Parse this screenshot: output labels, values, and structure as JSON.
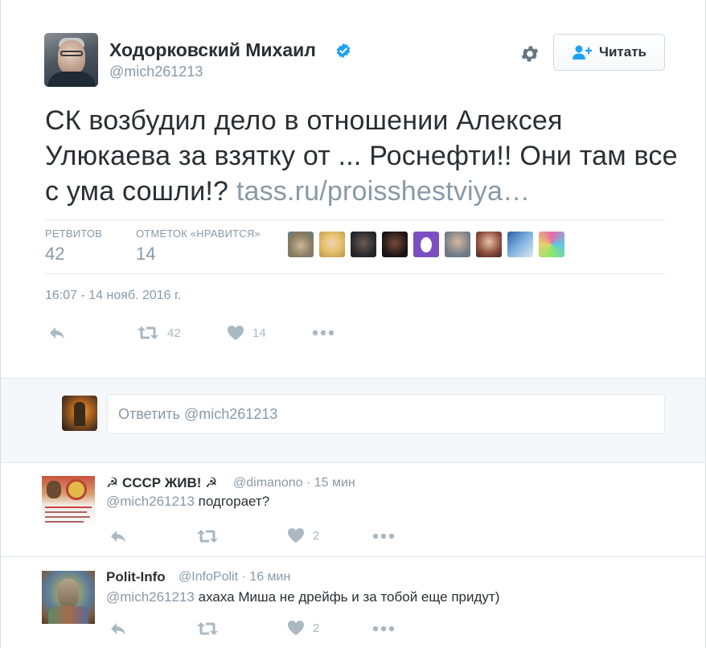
{
  "tweet": {
    "author_name": "Ходорковский Михаил",
    "author_handle": "@mich261213",
    "text": "СК возбудил дело в отношении Алексея Улюкаева за взятку от ... Роснефти!! Они там все с ума сошли!?",
    "link": "tass.ru/proisshestviya…",
    "follow_label": "Читать",
    "stats": {
      "retweets_label": "РЕТВИТОВ",
      "retweets_value": "42",
      "likes_label": "ОТМЕТОК «НРАВИТСЯ»",
      "likes_value": "14"
    },
    "timestamp": "16:07 - 14 нояб. 2016 г.",
    "actions": {
      "retweet_count": "42",
      "like_count": "14"
    }
  },
  "reply_box": {
    "placeholder": "Ответить @mich261213"
  },
  "comments": [
    {
      "name": "☭ СССР ЖИВ! ☭",
      "handle": "@dimanono",
      "time": "15 мин",
      "mention": "@mich261213",
      "text": "подгорает?",
      "like_count": "2"
    },
    {
      "name": "Polit-Info",
      "handle": "@InfoPolit",
      "time": "16 мин",
      "mention": "@mich261213",
      "text": "ахаха Миша не дрейфь  и за тобой еще придут)",
      "like_count": "2"
    }
  ],
  "icons": {
    "verified": "verified-badge-icon",
    "gear": "gear-icon",
    "follow": "follow-user-icon",
    "reply": "reply-icon",
    "retweet": "retweet-icon",
    "like": "heart-icon",
    "more": "more-dots-icon"
  },
  "colors": {
    "verified_blue": "#1da1f2",
    "muted_text": "#8899a6",
    "main_text": "#292f33",
    "action_gray": "#aab8c2"
  }
}
